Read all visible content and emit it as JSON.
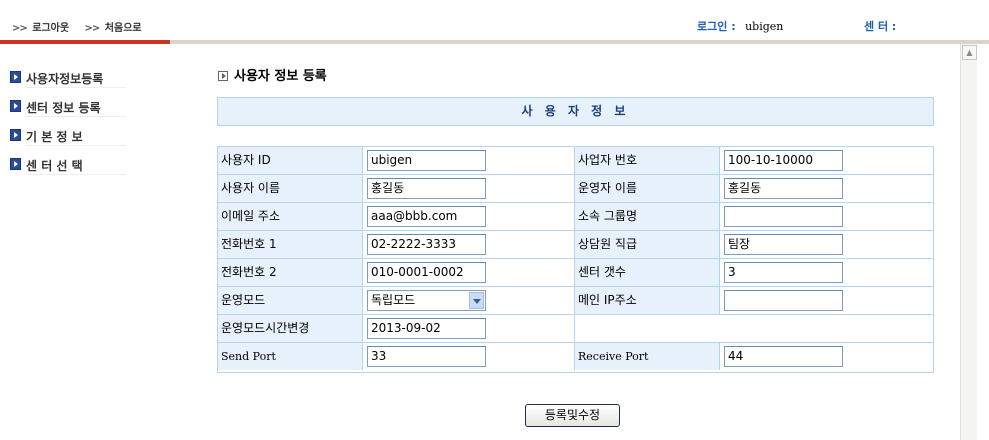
{
  "top": {
    "logout": "로그아웃",
    "home": "처음으로",
    "login_label": "로그인 :",
    "login_user": "ubigen",
    "center_label": "센 터 :"
  },
  "menu": {
    "items": [
      {
        "label": "사용자정보등록"
      },
      {
        "label": "센터 정보 등록"
      },
      {
        "label": "기 본 정 보"
      },
      {
        "label": "센 터 선 택"
      }
    ]
  },
  "page": {
    "title": "사용자 정보 등록",
    "section": "사 용 자 정 보"
  },
  "form": {
    "rows": [
      {
        "l1": "사용자 ID",
        "v1": "ubigen",
        "l2": "사업자 번호",
        "v2": "100-10-10000"
      },
      {
        "l1": "사용자 이름",
        "v1": "홍길동",
        "l2": "운영자 이름",
        "v2": "홍길동"
      },
      {
        "l1": "이메일 주소",
        "v1": "aaa@bbb.com",
        "l2": "소속 그룹명",
        "v2": ""
      },
      {
        "l1": "전화번호 1",
        "v1": "02-2222-3333",
        "l2": "상담원 직급",
        "v2": "팀장"
      },
      {
        "l1": "전화번호 2",
        "v1": "010-0001-0002",
        "l2": "센터 갯수",
        "v2": "3"
      },
      {
        "l1": "운영모드",
        "v1": "독립모드",
        "l2": "메인 IP주소",
        "v2": ""
      },
      {
        "l1": "운영모드시간변경",
        "v1": "2013-09-02"
      },
      {
        "l1": "Send Port",
        "v1": "33",
        "l2": "Receive Port",
        "v2": "44"
      }
    ]
  },
  "submit_label": "등록및수정",
  "colors": {
    "accent_red": "#cc3322",
    "header_blue": "#1a5fb4",
    "cell_bg": "#e6f1fb",
    "cell_border": "#b8d3ee"
  }
}
